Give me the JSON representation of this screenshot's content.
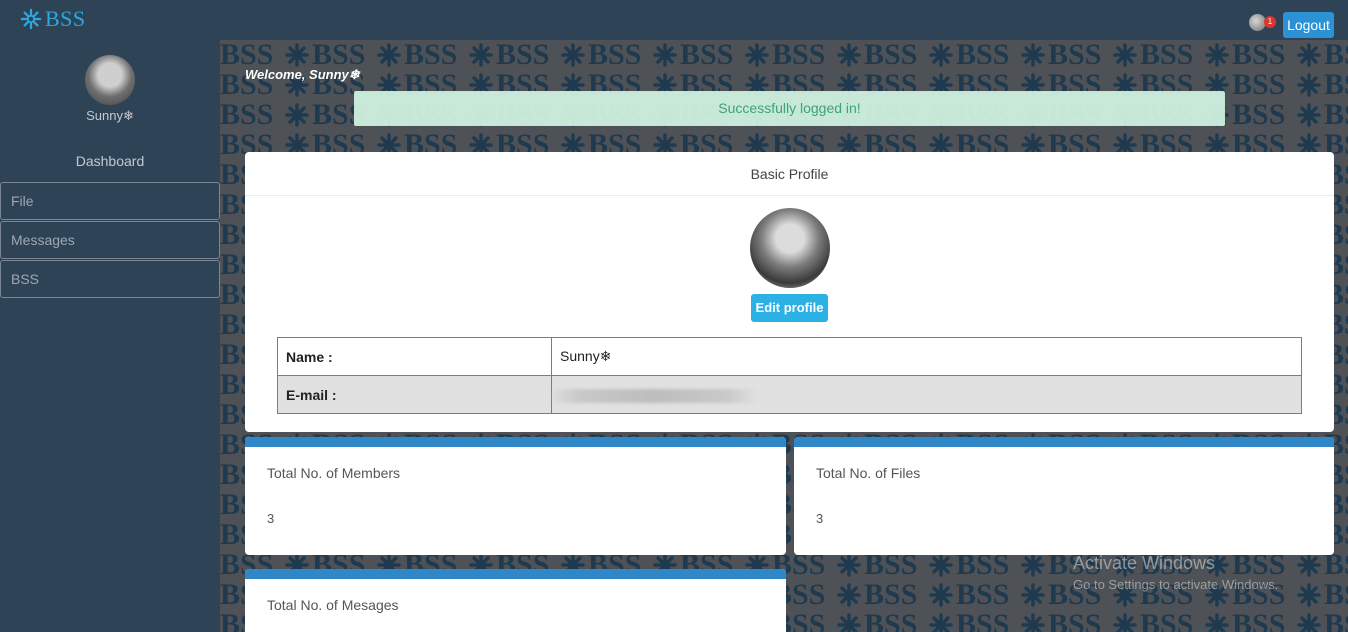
{
  "topbar": {
    "brand_text": "BSS",
    "notification_count": "1",
    "logout_label": "Logout"
  },
  "sidebar": {
    "username": "Sunny❄",
    "dashboard_label": "Dashboard",
    "items": [
      {
        "label": "File"
      },
      {
        "label": "Messages"
      },
      {
        "label": "BSS"
      }
    ]
  },
  "background": {
    "pattern_text": "BSS",
    "pattern_color": "#1f3a4f"
  },
  "main": {
    "welcome": "Welcome, Sunny❄",
    "alert": "Successfully logged in!",
    "profile": {
      "title": "Basic Profile",
      "edit_label": "Edit profile",
      "name_label": "Name :",
      "name_value": "Sunny❄",
      "email_label": "E-mail :"
    },
    "stats": [
      {
        "title": "Total No. of Members",
        "value": "3"
      },
      {
        "title": "Total No. of Files",
        "value": "3"
      },
      {
        "title": "Total No. of Mesages",
        "value": ""
      }
    ]
  },
  "watermark": {
    "line1": "Activate Windows",
    "line2": "Go to Settings to activate Windows."
  },
  "colors": {
    "accent": "#2aa8df",
    "stat_bar": "#2f87c8",
    "success_text": "#3ea27a"
  }
}
